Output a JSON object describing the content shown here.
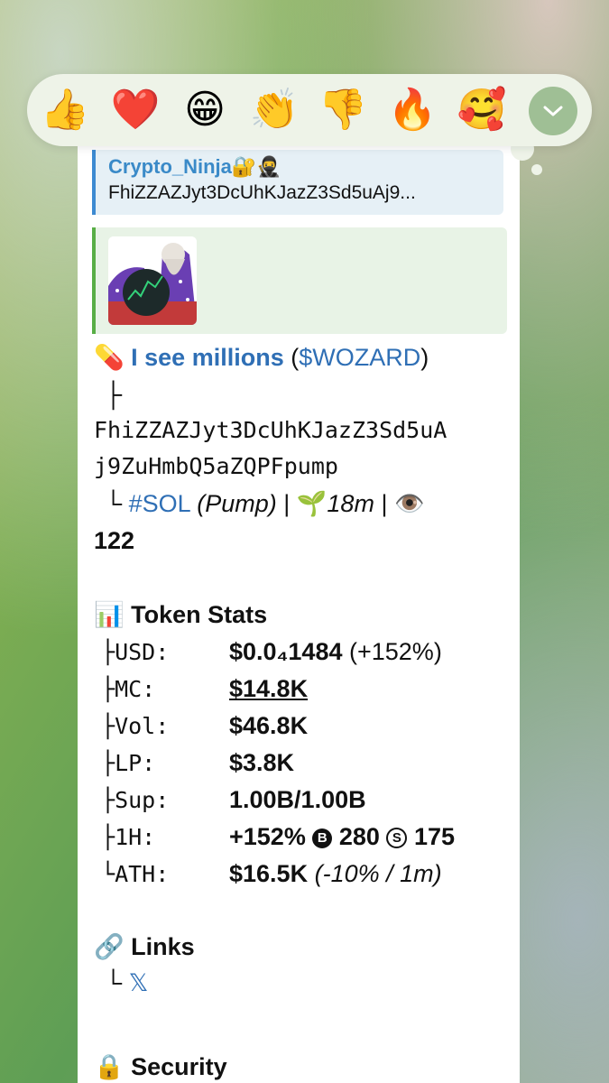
{
  "reactions": [
    {
      "name": "thumbs-up",
      "glyph": "👍"
    },
    {
      "name": "red-heart",
      "glyph": "❤️"
    },
    {
      "name": "grinning-face",
      "glyph": "😁"
    },
    {
      "name": "clapping-hands",
      "glyph": "👏"
    },
    {
      "name": "thumbs-down",
      "glyph": "👎"
    },
    {
      "name": "fire",
      "glyph": "🔥"
    },
    {
      "name": "smiling-face-with-hearts",
      "glyph": "🥰"
    }
  ],
  "reply": {
    "author": "Crypto_Ninja🔐🥷",
    "text": "FhiZZAZJyt3DcUhKJazZ3Sd5uAj9..."
  },
  "token": {
    "pill_emoji": "💊",
    "name": "I see millions",
    "ticker_open": "(",
    "ticker": "$WOZARD",
    "ticker_close": ")",
    "tree_branch": "├",
    "address_line1": "FhiZZAZJyt3DcUhKJazZ3Sd5uA",
    "address_line2": "j9ZuHmbQ5aZQPFpump",
    "tree_end": "└",
    "chain": "#SOL",
    "platform": "(Pump)",
    "sep": "|",
    "age_emoji": "🌱",
    "age": "18m",
    "views_emoji": "👁️",
    "views": "122"
  },
  "stats": {
    "heading_emoji": "📊",
    "heading": "Token Stats",
    "rows": [
      {
        "prefix": "├",
        "label": "USD:",
        "value": "$0.0₄1484",
        "extra": "(+152%)"
      },
      {
        "prefix": "├",
        "label": "MC:",
        "value": "$14.8K",
        "extra": ""
      },
      {
        "prefix": "├",
        "label": "Vol:",
        "value": "$46.8K",
        "extra": ""
      },
      {
        "prefix": "├",
        "label": "LP:",
        "value": "$3.8K",
        "extra": ""
      },
      {
        "prefix": "├",
        "label": "Sup:",
        "value": "1.00B/1.00B",
        "extra": ""
      },
      {
        "prefix": "├",
        "label": "1H:",
        "value": "+152%",
        "extra": ""
      },
      {
        "prefix": "└",
        "label": "ATH:",
        "value": "$16.5K",
        "extra": "(-10% / 1m)"
      }
    ],
    "buys_badge": "B",
    "buys": "280",
    "sells_badge": "S",
    "sells": "175"
  },
  "links": {
    "heading_emoji": "🔗",
    "heading": "Links",
    "tree_end": "└",
    "x_link": "𝕏"
  },
  "security": {
    "heading_emoji": "🔒",
    "heading": "Security"
  },
  "colors": {
    "link": "#2f6fb5",
    "reply_accent": "#3d8ad1",
    "media_accent": "#58ae46"
  }
}
